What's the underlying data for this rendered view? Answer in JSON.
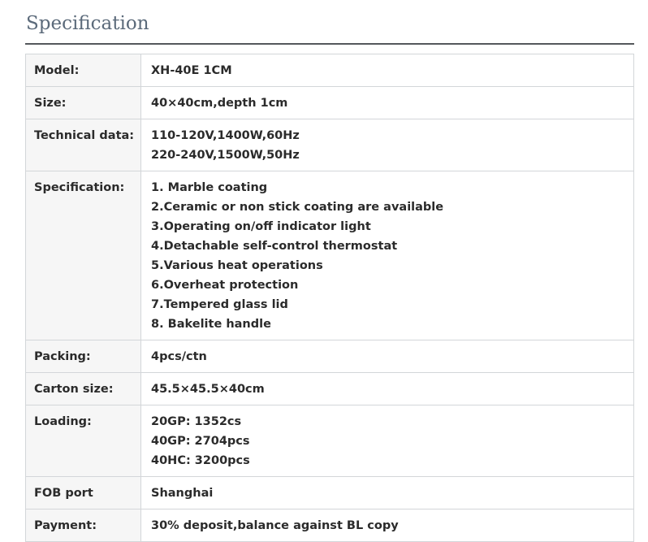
{
  "heading": "Specification",
  "rows": [
    {
      "label": "Model:",
      "lines": [
        "XH-40E 1CM"
      ]
    },
    {
      "label": "Size:",
      "lines": [
        "40×40cm,depth 1cm"
      ]
    },
    {
      "label": "Technical data:",
      "lines": [
        "110-120V,1400W,60Hz",
        "220-240V,1500W,50Hz"
      ]
    },
    {
      "label": "Specification:",
      "lines": [
        "1. Marble coating",
        "2.Ceramic or non stick coating are available",
        "3.Operating on/off indicator light",
        "4.Detachable self-control thermostat",
        "5.Various heat operations",
        "6.Overheat protection",
        "7.Tempered glass lid",
        "8. Bakelite handle"
      ]
    },
    {
      "label": "Packing:",
      "lines": [
        "4pcs/ctn"
      ]
    },
    {
      "label": "Carton size:",
      "lines": [
        "45.5×45.5×40cm"
      ]
    },
    {
      "label": "Loading:",
      "lines": [
        "20GP: 1352cs",
        "40GP: 2704pcs",
        "40HC: 3200pcs"
      ]
    },
    {
      "label": "FOB port",
      "lines": [
        "Shanghai"
      ]
    },
    {
      "label": "Payment:",
      "lines": [
        "30% deposit,balance against BL copy"
      ]
    }
  ]
}
